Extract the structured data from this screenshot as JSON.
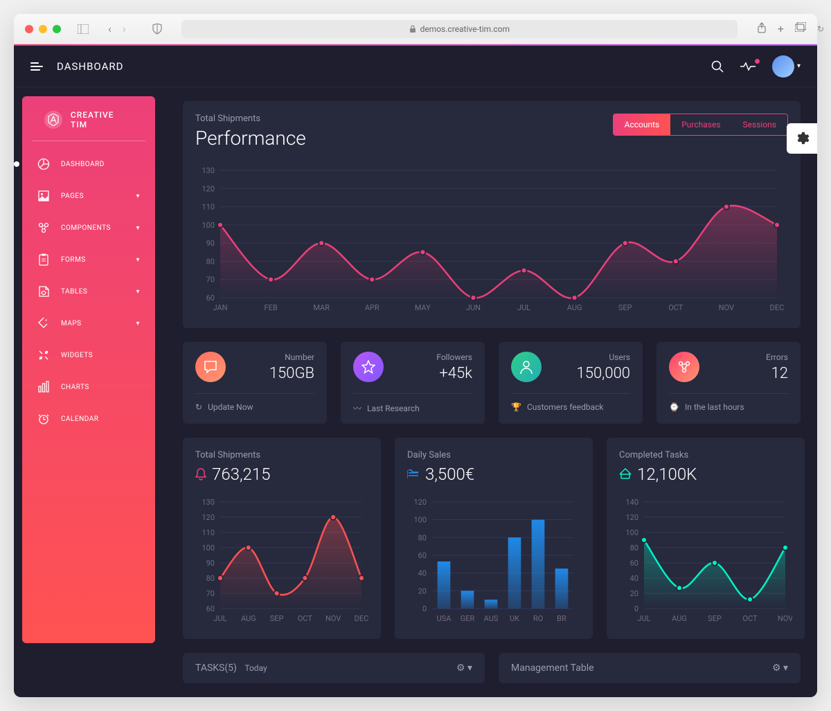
{
  "browser": {
    "url": "demos.creative-tim.com"
  },
  "header": {
    "title": "DASHBOARD"
  },
  "sidebar": {
    "brand": "CREATIVE TIM",
    "items": [
      {
        "label": "DASHBOARD",
        "expandable": false,
        "active": true
      },
      {
        "label": "PAGES",
        "expandable": true
      },
      {
        "label": "COMPONENTS",
        "expandable": true
      },
      {
        "label": "FORMS",
        "expandable": true
      },
      {
        "label": "TABLES",
        "expandable": true
      },
      {
        "label": "MAPS",
        "expandable": true
      },
      {
        "label": "WIDGETS",
        "expandable": false
      },
      {
        "label": "CHARTS",
        "expandable": false
      },
      {
        "label": "CALENDAR",
        "expandable": false
      }
    ]
  },
  "performance": {
    "subtitle": "Total Shipments",
    "title": "Performance",
    "tabs": [
      {
        "label": "Accounts",
        "active": true
      },
      {
        "label": "Purchases",
        "active": false
      },
      {
        "label": "Sessions",
        "active": false
      }
    ]
  },
  "stats": [
    {
      "label": "Number",
      "value": "150GB",
      "footer": "Update Now"
    },
    {
      "label": "Followers",
      "value": "+45k",
      "footer": "Last Research"
    },
    {
      "label": "Users",
      "value": "150,000",
      "footer": "Customers feedback"
    },
    {
      "label": "Errors",
      "value": "12",
      "footer": "In the last hours"
    }
  ],
  "mini": [
    {
      "subtitle": "Total Shipments",
      "value": "763,215"
    },
    {
      "subtitle": "Daily Sales",
      "value": "3,500€"
    },
    {
      "subtitle": "Completed Tasks",
      "value": "12,100K"
    }
  ],
  "bottom": {
    "tasks_title": "TASKS(5)",
    "tasks_sub": "Today",
    "mgmt_title": "Management Table"
  },
  "chart_data": [
    {
      "type": "line",
      "title": "Performance",
      "categories": [
        "JAN",
        "FEB",
        "MAR",
        "APR",
        "MAY",
        "JUN",
        "JUL",
        "AUG",
        "SEP",
        "OCT",
        "NOV",
        "DEC"
      ],
      "values": [
        100,
        70,
        90,
        70,
        85,
        60,
        75,
        60,
        90,
        80,
        110,
        100
      ],
      "ylabel": "",
      "ylim": [
        60,
        130
      ],
      "yticks": [
        60,
        70,
        80,
        90,
        100,
        110,
        120,
        130
      ],
      "color": "#ec407a"
    },
    {
      "type": "line",
      "title": "Total Shipments",
      "categories": [
        "JUL",
        "AUG",
        "SEP",
        "OCT",
        "NOV",
        "DEC"
      ],
      "values": [
        80,
        100,
        70,
        80,
        120,
        80
      ],
      "ylim": [
        60,
        130
      ],
      "yticks": [
        60,
        70,
        80,
        90,
        100,
        110,
        120,
        130
      ],
      "color": "#ff5252"
    },
    {
      "type": "bar",
      "title": "Daily Sales",
      "categories": [
        "USA",
        "GER",
        "AUS",
        "UK",
        "RO",
        "BR"
      ],
      "values": [
        53,
        20,
        10,
        80,
        100,
        45
      ],
      "ylim": [
        0,
        120
      ],
      "yticks": [
        0,
        20,
        40,
        60,
        80,
        100,
        120
      ],
      "color": "#1f8ef1"
    },
    {
      "type": "line",
      "title": "Completed Tasks",
      "categories": [
        "JUL",
        "AUG",
        "SEP",
        "OCT",
        "NOV"
      ],
      "values": [
        90,
        27,
        60,
        12,
        80
      ],
      "ylim": [
        0,
        140
      ],
      "yticks": [
        0,
        20,
        40,
        60,
        80,
        100,
        120,
        140
      ],
      "color": "#00f2c3"
    }
  ]
}
